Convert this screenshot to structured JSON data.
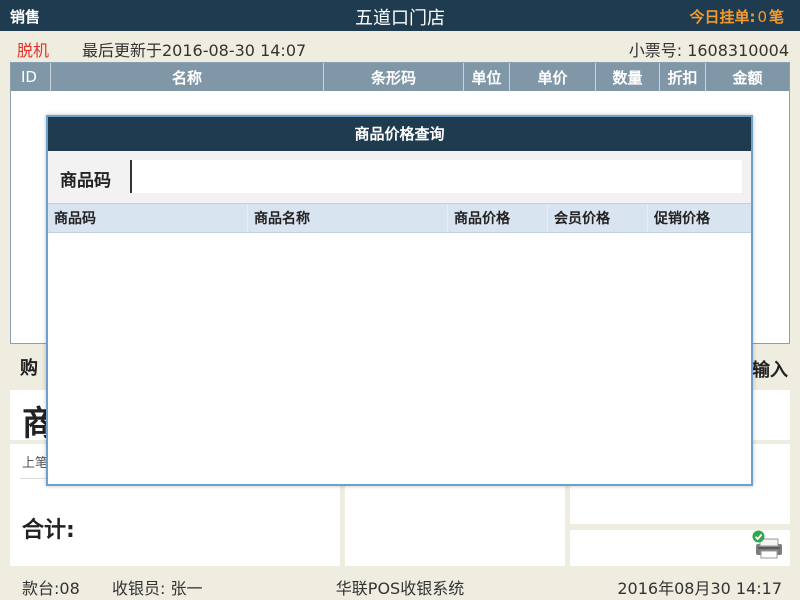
{
  "topbar": {
    "mode_label": "销售",
    "store_name": "五道口门店",
    "held_label": "今日挂单:",
    "held_count": "0",
    "held_unit": "笔"
  },
  "status": {
    "offline": "脱机",
    "last_updated": "最后更新于2016-08-30 14:07",
    "ticket_no": "小票号: 1608310004"
  },
  "grid": {
    "columns": [
      "ID",
      "名称",
      "条形码",
      "单位",
      "单价",
      "数量",
      "折扣",
      "金额"
    ]
  },
  "lower": {
    "cart_label": "购",
    "input_label": "输入",
    "big_char": "商",
    "small_label": "上笔",
    "total_label": "合计:"
  },
  "footer": {
    "counter": "款台:08",
    "cashier": "收银员: 张一",
    "system_name": "华联POS收银系统",
    "datetime": "2016年08月30  14:17"
  },
  "dialog": {
    "title": "商品价格查询",
    "search_label": "商品码",
    "search_value": "",
    "columns": [
      "商品码",
      "商品名称",
      "商品价格",
      "会员价格",
      "促销价格"
    ]
  },
  "icons": {
    "printer": "printer-icon",
    "check": "check-icon"
  },
  "colors": {
    "header_bg": "#1f3b4f",
    "accent_orange": "#f29a2e",
    "offline_red": "#e0332a",
    "grid_header_bg": "#8097a8"
  }
}
